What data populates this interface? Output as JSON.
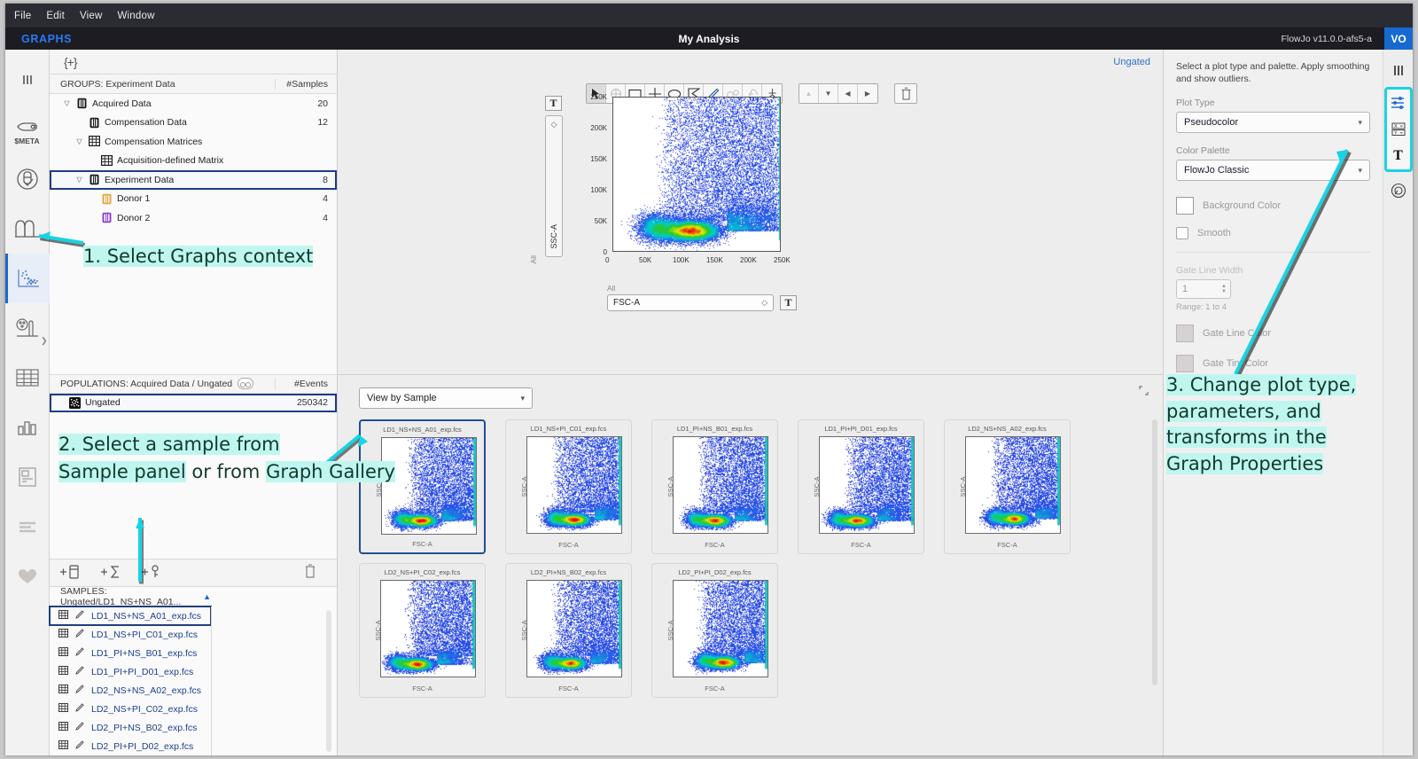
{
  "window": {
    "menu": [
      "File",
      "Edit",
      "View",
      "Window"
    ],
    "context_label": "GRAPHS",
    "doc_title": "My Analysis",
    "version": "FlowJo v11.0.0-afs5-a",
    "avatar_initials": "VO",
    "accent_blue": "#1769d0",
    "anno_cyan": "#19d3e3",
    "anno_highlight": "#bff6f0"
  },
  "left_rail": {
    "items": [
      {
        "name": "columns-icon",
        "label": ""
      },
      {
        "name": "keyword-meta-icon",
        "label": "$META"
      },
      {
        "name": "compensation-tube-icon",
        "label": ""
      },
      {
        "name": "histogram-peaks-icon",
        "label": ""
      },
      {
        "name": "graphs-scatter-icon",
        "label": ""
      },
      {
        "name": "palette-plot-icon",
        "label": ""
      },
      {
        "name": "table-icon",
        "label": ""
      },
      {
        "name": "bar-chart-icon",
        "label": ""
      },
      {
        "name": "layout-report-icon",
        "label": ""
      },
      {
        "name": "lines-icon",
        "label": ""
      },
      {
        "name": "heart-icon",
        "label": ""
      }
    ],
    "active_index": 4
  },
  "workspace": {
    "add_group_button": "{+}",
    "groups": {
      "header": "GROUPS: Experiment Data",
      "count_header": "#Samples",
      "rows": [
        {
          "label": "Acquired Data",
          "count": "20",
          "depth": 0,
          "twisty": "open",
          "icon": "tube-black",
          "selected": false
        },
        {
          "label": "Compensation Data",
          "count": "12",
          "depth": 1,
          "twisty": "none",
          "icon": "tube-black",
          "selected": false
        },
        {
          "label": "Compensation Matrices",
          "count": "",
          "depth": 1,
          "twisty": "open",
          "icon": "matrix-black",
          "selected": false
        },
        {
          "label": "Acquisition-defined Matrix",
          "count": "",
          "depth": 2,
          "twisty": "none",
          "icon": "grid-black",
          "selected": false
        },
        {
          "label": "Experiment Data",
          "count": "8",
          "depth": 1,
          "twisty": "open",
          "icon": "tube-black",
          "selected": true
        },
        {
          "label": "Donor 1",
          "count": "4",
          "depth": 2,
          "twisty": "none",
          "icon": "tube-orange",
          "selected": false
        },
        {
          "label": "Donor 2",
          "count": "4",
          "depth": 2,
          "twisty": "none",
          "icon": "tube-purple",
          "selected": false
        }
      ]
    },
    "populations": {
      "header": "POPULATIONS: Acquired Data / Ungated",
      "count_header": "#Events",
      "rows": [
        {
          "label": "Ungated",
          "count": "250342",
          "icon": "ungated-dots",
          "selected": true
        }
      ]
    },
    "samples_toolbar": {
      "add_statistic": "+∑",
      "add_tube": "+",
      "add_keyword": "+",
      "delete": "trash"
    },
    "samples": {
      "header": "SAMPLES: Ungated/LD1_NS+NS_A01...",
      "rows": [
        {
          "label": "LD1_NS+NS_A01_exp.fcs",
          "selected": true
        },
        {
          "label": "LD1_NS+PI_C01_exp.fcs",
          "selected": false
        },
        {
          "label": "LD1_PI+NS_B01_exp.fcs",
          "selected": false
        },
        {
          "label": "LD1_PI+PI_D01_exp.fcs",
          "selected": false
        },
        {
          "label": "LD2_NS+NS_A02_exp.fcs",
          "selected": false
        },
        {
          "label": "LD2_NS+PI_C02_exp.fcs",
          "selected": false
        },
        {
          "label": "LD2_PI+NS_B02_exp.fcs",
          "selected": false
        },
        {
          "label": "LD2_PI+PI_D02_exp.fcs",
          "selected": false
        }
      ]
    }
  },
  "graph_area": {
    "ungated_link": "Ungated",
    "gate_tools": [
      {
        "name": "pointer-tool",
        "active": true,
        "dim": false
      },
      {
        "name": "crosshair-target-tool",
        "active": false,
        "dim": true
      },
      {
        "name": "rectangle-gate-tool",
        "active": false,
        "dim": false
      },
      {
        "name": "quadrant-gate-tool",
        "active": false,
        "dim": false
      },
      {
        "name": "ellipse-gate-tool",
        "active": false,
        "dim": false
      },
      {
        "name": "polygon-gate-tool",
        "active": false,
        "dim": false
      },
      {
        "name": "pencil-freehand-gate-tool",
        "active": false,
        "dim": false
      },
      {
        "name": "binary-gate-tool",
        "active": false,
        "dim": true
      },
      {
        "name": "spline-gate-tool",
        "active": false,
        "dim": true
      },
      {
        "name": "autogate-tool",
        "active": false,
        "dim": false
      }
    ],
    "nav_buttons": [
      {
        "name": "nav-up-button",
        "glyph": "▲",
        "dim": true
      },
      {
        "name": "nav-down-button",
        "glyph": "▼",
        "dim": false
      },
      {
        "name": "nav-back-button",
        "glyph": "◀",
        "dim": false
      },
      {
        "name": "nav-forward-button",
        "glyph": "▶",
        "dim": false
      }
    ],
    "delete_button": "trash",
    "y_axis_transform_button": "T",
    "x_axis_transform_button": "T",
    "y_param_label": "SSC-A",
    "y_scope_label": "All",
    "x_param_value": "FSC-A",
    "x_scope_label": "All",
    "right_y_param_label": "SSC-A",
    "right_y_scope_label": "All"
  },
  "chart_data": {
    "type": "scatter",
    "title": "",
    "xlabel": "FSC-A",
    "ylabel": "SSC-A",
    "xlim": [
      0,
      262144
    ],
    "ylim": [
      0,
      262144
    ],
    "xticks": [
      "0",
      "50K",
      "100K",
      "150K",
      "200K",
      "250K"
    ],
    "yticks": [
      "0",
      "50K",
      "100K",
      "150K",
      "200K",
      "250K"
    ],
    "grid": false,
    "legend": "none",
    "palette": "FlowJo Classic",
    "total_events": 250342,
    "density_peak": {
      "x": 120000,
      "y": 32000,
      "color": "#e80000"
    },
    "notes": "Pseudocolor density scatter, main population centered near FSC-A 120K / SSC-A 32K with diffuse upper cloud"
  },
  "gallery": {
    "view_mode": "View by Sample",
    "expand_icon": "expand-icon",
    "x_label": "FSC-A",
    "y_label": "SSC-A",
    "cards": [
      {
        "name": "LD1_NS+NS_A01_exp.fcs",
        "selected": true
      },
      {
        "name": "LD1_NS+PI_C01_exp.fcs",
        "selected": false
      },
      {
        "name": "LD1_PI+NS_B01_exp.fcs",
        "selected": false
      },
      {
        "name": "LD1_PI+PI_D01_exp.fcs",
        "selected": false
      },
      {
        "name": "LD2_NS+NS_A02_exp.fcs",
        "selected": false
      },
      {
        "name": "LD2_NS+PI_C02_exp.fcs",
        "selected": false
      },
      {
        "name": "LD2_PI+NS_B02_exp.fcs",
        "selected": false
      },
      {
        "name": "LD2_PI+PI_D02_exp.fcs",
        "selected": false
      }
    ]
  },
  "properties": {
    "description": "Select a plot type and palette. Apply smoothing and show outliers.",
    "plot_type_label": "Plot Type",
    "plot_type_value": "Pseudocolor",
    "color_palette_label": "Color Palette",
    "color_palette_value": "FlowJo Classic",
    "background_color_label": "Background Color",
    "smooth_label": "Smooth",
    "gate_line_width_label": "Gate Line Width",
    "gate_line_width_value": "1",
    "gate_line_width_range": "Range: 1 to 4",
    "gate_line_color_label": "Gate Line Color",
    "gate_tint_color_label": "Gate Tint Color",
    "rail": [
      {
        "name": "props-panel-columns-icon",
        "glyph": "|||",
        "grouped": false
      },
      {
        "name": "graph-properties-sliders-icon",
        "glyph": "sliders",
        "grouped": true
      },
      {
        "name": "axis-parameters-icon",
        "glyph": "xy",
        "grouped": true
      },
      {
        "name": "text-annotations-icon",
        "glyph": "T",
        "grouped": true
      },
      {
        "name": "overlays-icon",
        "glyph": "circle",
        "grouped": false
      }
    ]
  },
  "annotations": [
    {
      "id": "step1",
      "text": "1. Select Graphs context",
      "prefix": "1. Select ",
      "highlight": "Graphs context"
    },
    {
      "id": "step2a",
      "text": "2. Select a sample from"
    },
    {
      "id": "step2b_pre",
      "text": "Sample panel"
    },
    {
      "id": "step2b_mid",
      "text": " or from "
    },
    {
      "id": "step2b_post",
      "text": "Graph Gallery"
    },
    {
      "id": "step3l1",
      "text": "3. Change plot type,"
    },
    {
      "id": "step3l2",
      "text": "parameters, and"
    },
    {
      "id": "step3l3",
      "text": "transforms in the"
    },
    {
      "id": "step3l4",
      "text": "Graph Properties"
    }
  ]
}
